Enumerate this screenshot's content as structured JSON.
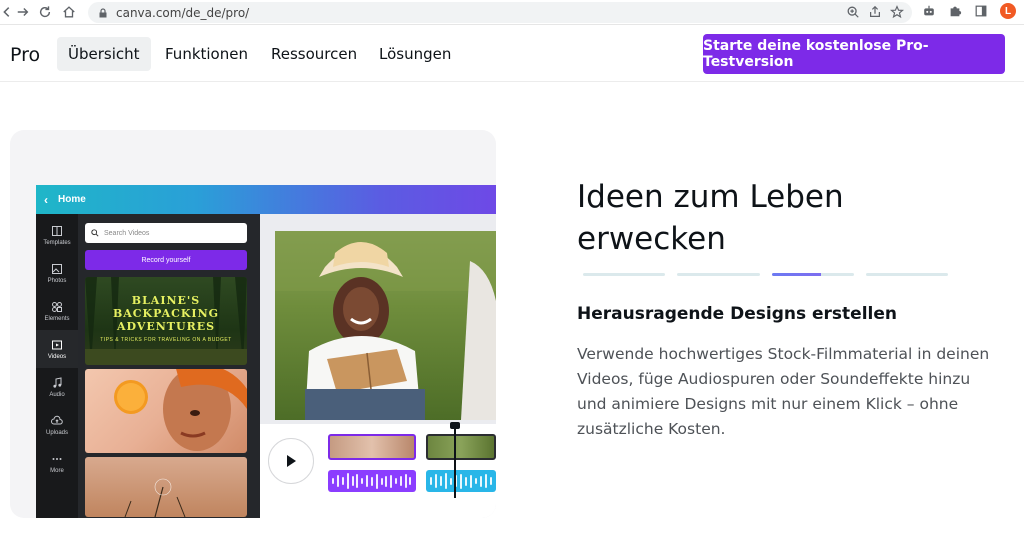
{
  "browser": {
    "url": "canva.com/de_de/pro/"
  },
  "header": {
    "logo": "Pro",
    "nav": [
      "Übersicht",
      "Funktionen",
      "Ressourcen",
      "Lösungen"
    ],
    "cta": "Starte deine kostenlose Pro-Testversion"
  },
  "editor": {
    "home_label": "Home",
    "rail": [
      "Templates",
      "Photos",
      "Elements",
      "Videos",
      "Audio",
      "Uploads",
      "More"
    ],
    "search_placeholder": "Search Videos",
    "record_label": "Record yourself",
    "thumb_title": "BLAINE'S BACKPACKING ADVENTURES",
    "thumb_subtitle": "TIPS & TRICKS FOR TRAVELING ON A BUDGET"
  },
  "hero": {
    "title": "Ideen zum Leben erwecken",
    "feature_title": "Herausragende Designs erstellen",
    "feature_text": "Verwende hochwertiges Stock-Filmmaterial in deinen Videos, füge Audiospuren oder Soundeffekte hinzu und animiere Designs mit nur einem Klick – ohne zusätzliche Kosten."
  },
  "colors": {
    "brand": "#7d2ae8",
    "title": "#0e1318",
    "body": "#4e5257"
  }
}
